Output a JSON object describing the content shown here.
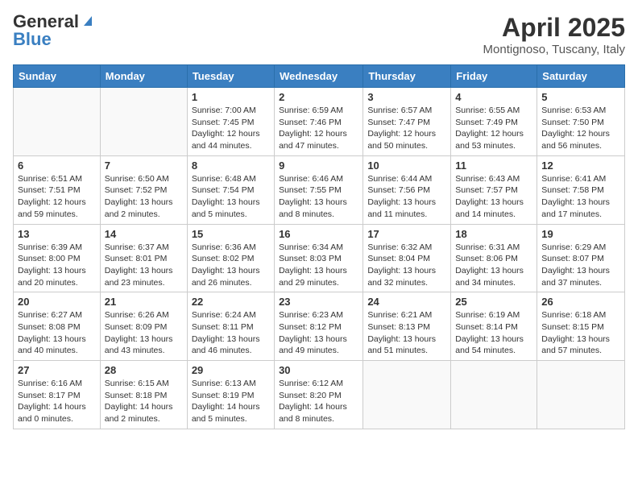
{
  "header": {
    "logo_general": "General",
    "logo_blue": "Blue",
    "title": "April 2025",
    "location": "Montignoso, Tuscany, Italy"
  },
  "weekdays": [
    "Sunday",
    "Monday",
    "Tuesday",
    "Wednesday",
    "Thursday",
    "Friday",
    "Saturday"
  ],
  "weeks": [
    [
      {
        "day": "",
        "info": ""
      },
      {
        "day": "",
        "info": ""
      },
      {
        "day": "1",
        "info": "Sunrise: 7:00 AM\nSunset: 7:45 PM\nDaylight: 12 hours\nand 44 minutes."
      },
      {
        "day": "2",
        "info": "Sunrise: 6:59 AM\nSunset: 7:46 PM\nDaylight: 12 hours\nand 47 minutes."
      },
      {
        "day": "3",
        "info": "Sunrise: 6:57 AM\nSunset: 7:47 PM\nDaylight: 12 hours\nand 50 minutes."
      },
      {
        "day": "4",
        "info": "Sunrise: 6:55 AM\nSunset: 7:49 PM\nDaylight: 12 hours\nand 53 minutes."
      },
      {
        "day": "5",
        "info": "Sunrise: 6:53 AM\nSunset: 7:50 PM\nDaylight: 12 hours\nand 56 minutes."
      }
    ],
    [
      {
        "day": "6",
        "info": "Sunrise: 6:51 AM\nSunset: 7:51 PM\nDaylight: 12 hours\nand 59 minutes."
      },
      {
        "day": "7",
        "info": "Sunrise: 6:50 AM\nSunset: 7:52 PM\nDaylight: 13 hours\nand 2 minutes."
      },
      {
        "day": "8",
        "info": "Sunrise: 6:48 AM\nSunset: 7:54 PM\nDaylight: 13 hours\nand 5 minutes."
      },
      {
        "day": "9",
        "info": "Sunrise: 6:46 AM\nSunset: 7:55 PM\nDaylight: 13 hours\nand 8 minutes."
      },
      {
        "day": "10",
        "info": "Sunrise: 6:44 AM\nSunset: 7:56 PM\nDaylight: 13 hours\nand 11 minutes."
      },
      {
        "day": "11",
        "info": "Sunrise: 6:43 AM\nSunset: 7:57 PM\nDaylight: 13 hours\nand 14 minutes."
      },
      {
        "day": "12",
        "info": "Sunrise: 6:41 AM\nSunset: 7:58 PM\nDaylight: 13 hours\nand 17 minutes."
      }
    ],
    [
      {
        "day": "13",
        "info": "Sunrise: 6:39 AM\nSunset: 8:00 PM\nDaylight: 13 hours\nand 20 minutes."
      },
      {
        "day": "14",
        "info": "Sunrise: 6:37 AM\nSunset: 8:01 PM\nDaylight: 13 hours\nand 23 minutes."
      },
      {
        "day": "15",
        "info": "Sunrise: 6:36 AM\nSunset: 8:02 PM\nDaylight: 13 hours\nand 26 minutes."
      },
      {
        "day": "16",
        "info": "Sunrise: 6:34 AM\nSunset: 8:03 PM\nDaylight: 13 hours\nand 29 minutes."
      },
      {
        "day": "17",
        "info": "Sunrise: 6:32 AM\nSunset: 8:04 PM\nDaylight: 13 hours\nand 32 minutes."
      },
      {
        "day": "18",
        "info": "Sunrise: 6:31 AM\nSunset: 8:06 PM\nDaylight: 13 hours\nand 34 minutes."
      },
      {
        "day": "19",
        "info": "Sunrise: 6:29 AM\nSunset: 8:07 PM\nDaylight: 13 hours\nand 37 minutes."
      }
    ],
    [
      {
        "day": "20",
        "info": "Sunrise: 6:27 AM\nSunset: 8:08 PM\nDaylight: 13 hours\nand 40 minutes."
      },
      {
        "day": "21",
        "info": "Sunrise: 6:26 AM\nSunset: 8:09 PM\nDaylight: 13 hours\nand 43 minutes."
      },
      {
        "day": "22",
        "info": "Sunrise: 6:24 AM\nSunset: 8:11 PM\nDaylight: 13 hours\nand 46 minutes."
      },
      {
        "day": "23",
        "info": "Sunrise: 6:23 AM\nSunset: 8:12 PM\nDaylight: 13 hours\nand 49 minutes."
      },
      {
        "day": "24",
        "info": "Sunrise: 6:21 AM\nSunset: 8:13 PM\nDaylight: 13 hours\nand 51 minutes."
      },
      {
        "day": "25",
        "info": "Sunrise: 6:19 AM\nSunset: 8:14 PM\nDaylight: 13 hours\nand 54 minutes."
      },
      {
        "day": "26",
        "info": "Sunrise: 6:18 AM\nSunset: 8:15 PM\nDaylight: 13 hours\nand 57 minutes."
      }
    ],
    [
      {
        "day": "27",
        "info": "Sunrise: 6:16 AM\nSunset: 8:17 PM\nDaylight: 14 hours\nand 0 minutes."
      },
      {
        "day": "28",
        "info": "Sunrise: 6:15 AM\nSunset: 8:18 PM\nDaylight: 14 hours\nand 2 minutes."
      },
      {
        "day": "29",
        "info": "Sunrise: 6:13 AM\nSunset: 8:19 PM\nDaylight: 14 hours\nand 5 minutes."
      },
      {
        "day": "30",
        "info": "Sunrise: 6:12 AM\nSunset: 8:20 PM\nDaylight: 14 hours\nand 8 minutes."
      },
      {
        "day": "",
        "info": ""
      },
      {
        "day": "",
        "info": ""
      },
      {
        "day": "",
        "info": ""
      }
    ]
  ]
}
